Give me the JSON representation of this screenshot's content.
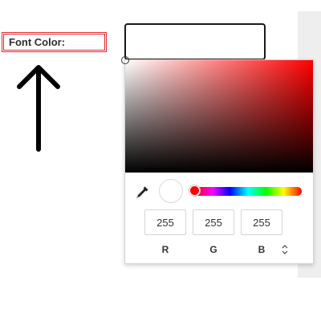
{
  "label": {
    "font_color": "Font Color:"
  },
  "picker": {
    "selected_color": "#ffffff",
    "hue_color": "#ff0000",
    "rgb": {
      "r": "255",
      "g": "255",
      "b": "255"
    },
    "channel_labels": {
      "r": "R",
      "g": "G",
      "b": "B"
    }
  },
  "icons": {
    "arrow": "up-arrow-icon",
    "eyedropper": "eyedropper-icon",
    "mode_toggle": "up-down-chevron-icon"
  },
  "colors": {
    "label_border": "#e32b2b",
    "side_panel": "#eeeeee"
  }
}
